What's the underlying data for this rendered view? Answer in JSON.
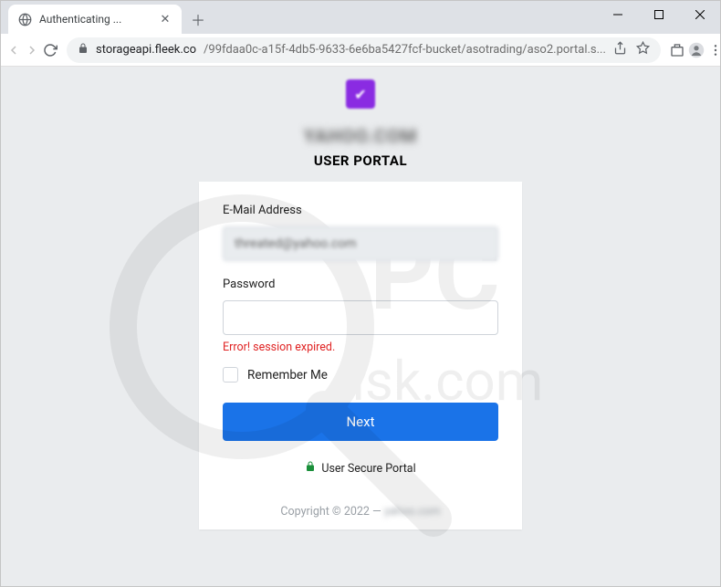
{
  "browser": {
    "tab_title": "Authenticating ...",
    "url_domain": "storageapi.fleek.co",
    "url_path": "/99fdaa0c-a15f-4db5-9633-6e6ba5427fcf-bucket/asotrading/aso2.portal.s..."
  },
  "page": {
    "blurred_heading": "YAHOO.COM",
    "title": "USER PORTAL",
    "email_label": "E-Mail Address",
    "email_value": "threated@yahoo.com",
    "password_label": "Password",
    "password_value": "",
    "error_text": "Error! session expired.",
    "remember_label": "Remember Me",
    "next_label": "Next",
    "secure_label": "User Secure Portal",
    "copyright_prefix": "Copyright © 2022 — ",
    "copyright_blur": "yahoo.com"
  }
}
